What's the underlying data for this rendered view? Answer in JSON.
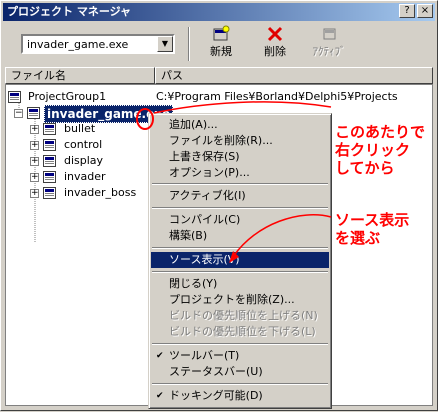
{
  "window": {
    "title": "プロジェクト マネージャ"
  },
  "titlebar_buttons": {
    "help": "?",
    "close": "×"
  },
  "toolbar": {
    "combo_value": "invader_game.exe",
    "new_label": "新規",
    "delete_label": "削除",
    "activate_label": "ｱｸﾃｨﾌﾞ"
  },
  "columns": {
    "name": "ファイル名",
    "path": "パス"
  },
  "tree": {
    "group": {
      "name": "ProjectGroup1",
      "path": "C:¥Program Files¥Borland¥Delphi5¥Projects"
    },
    "project": "invader_game.exe",
    "units": [
      "bullet",
      "control",
      "display",
      "invader",
      "invader_boss"
    ]
  },
  "menu": {
    "items": [
      {
        "label": "追加(A)...",
        "state": "normal"
      },
      {
        "label": "ファイルを削除(R)...",
        "state": "normal"
      },
      {
        "label": "上書き保存(S)",
        "state": "normal"
      },
      {
        "label": "オプション(P)...",
        "state": "normal"
      },
      {
        "label": "アクティブ化(I)",
        "state": "normal"
      },
      {
        "label": "コンパイル(C)",
        "state": "normal"
      },
      {
        "label": "構築(B)",
        "state": "normal"
      },
      {
        "label": "ソース表示(V)",
        "state": "highlighted"
      },
      {
        "label": "閉じる(Y)",
        "state": "normal"
      },
      {
        "label": "プロジェクトを削除(Z)...",
        "state": "normal"
      },
      {
        "label": "ビルドの優先順位を上げる(N)",
        "state": "disabled"
      },
      {
        "label": "ビルドの優先順位を下げる(L)",
        "state": "disabled"
      },
      {
        "label": "ツールバー(T)",
        "state": "checked"
      },
      {
        "label": "ステータスバー(U)",
        "state": "normal"
      },
      {
        "label": "ドッキング可能(D)",
        "state": "checked"
      }
    ]
  },
  "annotations": {
    "right_click": [
      "このあたりで",
      "右クリック",
      "してから"
    ],
    "choose_source": [
      "ソース表示",
      "を選ぶ"
    ]
  },
  "colors": {
    "accent": "#0a246a",
    "annotation": "#ff0000",
    "face": "#d4d0c8"
  }
}
